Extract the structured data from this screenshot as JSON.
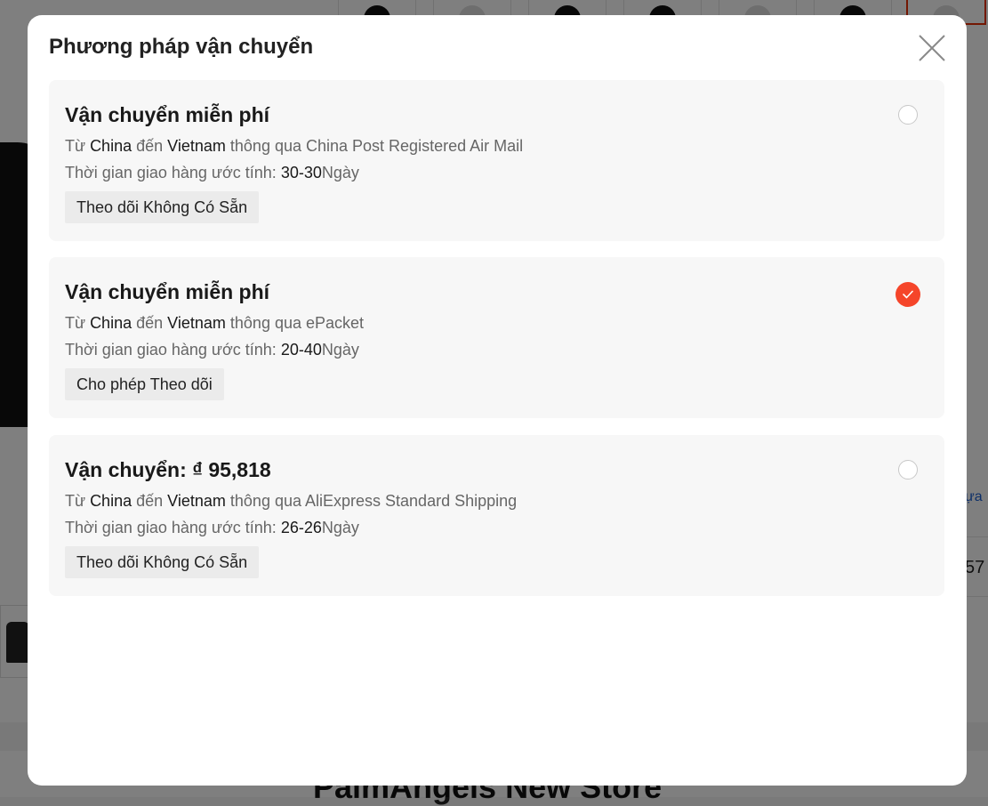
{
  "background": {
    "store_name": "PalmAngels New Store",
    "right_text": "57",
    "right_link": "ựa"
  },
  "modal": {
    "title": "Phương pháp vận chuyển",
    "options": [
      {
        "title": "Vận chuyển miễn phí",
        "from_prefix": "Từ",
        "from": "China",
        "to_prefix": "đến",
        "to": "Vietnam",
        "via_prefix": "thông qua",
        "carrier": "China Post Registered Air Mail",
        "time_label": "Thời gian giao hàng ước tính:",
        "time_range": "30-30",
        "time_unit": "Ngày",
        "tracking": "Theo dõi Không Có Sẵn",
        "selected": false
      },
      {
        "title": "Vận chuyển miễn phí",
        "from_prefix": "Từ",
        "from": "China",
        "to_prefix": "đến",
        "to": "Vietnam",
        "via_prefix": "thông qua",
        "carrier": "ePacket",
        "time_label": "Thời gian giao hàng ước tính:",
        "time_range": "20-40",
        "time_unit": "Ngày",
        "tracking": "Cho phép Theo dõi",
        "selected": true
      },
      {
        "title": "Vận chuyển: ₫ 95,818",
        "from_prefix": "Từ",
        "from": "China",
        "to_prefix": "đến",
        "to": "Vietnam",
        "via_prefix": "thông qua",
        "carrier": "AliExpress Standard Shipping",
        "time_label": "Thời gian giao hàng ước tính:",
        "time_range": "26-26",
        "time_unit": "Ngày",
        "tracking": "Theo dõi Không Có Sẵn",
        "selected": false
      }
    ]
  },
  "colors": {
    "accent": "#f5452a",
    "card_bg": "#f7f7f7",
    "badge_bg": "#ebebeb"
  }
}
